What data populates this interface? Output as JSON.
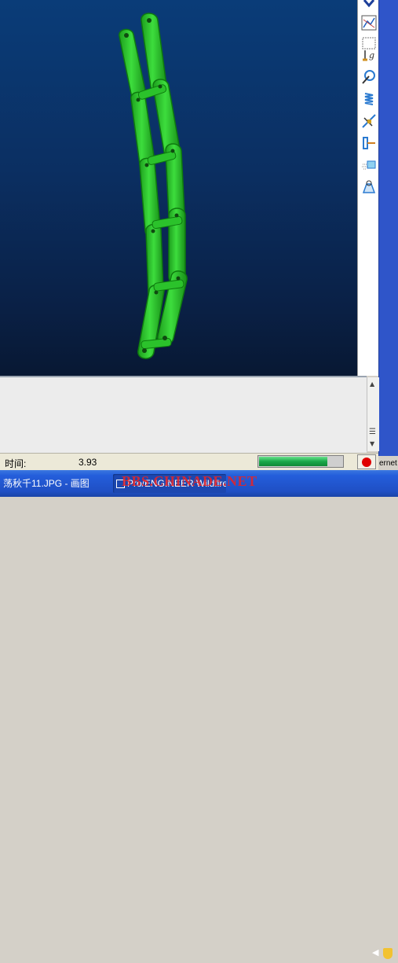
{
  "viewport": {
    "model_name": "chain-assembly-model",
    "background_top": "#0a3c78",
    "background_bottom": "#081833",
    "model_color": "#2ecf2e"
  },
  "right_toolbar": {
    "tools": [
      {
        "name": "collapse-arrow-icon"
      },
      {
        "name": "graph-icon"
      },
      {
        "name": "gravity-icon"
      },
      {
        "name": "motor-icon"
      },
      {
        "name": "spring-icon"
      },
      {
        "name": "damper-icon"
      },
      {
        "name": "force-torque-icon"
      },
      {
        "name": "initial-condition-icon"
      },
      {
        "name": "mass-properties-icon"
      }
    ]
  },
  "side_strip": {
    "edge_text": "ernet"
  },
  "status_bar": {
    "time_label": "时间:",
    "time_value": "3.93",
    "progress_fraction": 0.82,
    "progress_color": "#1aa84a",
    "stop_color": "#e00000"
  },
  "taskbar": {
    "item1_label": "荡秋千11.JPG - 画图",
    "item2_label": "Pro/ENGINEER Wildfire",
    "watermark": "BBS.CHINADE.NET"
  }
}
